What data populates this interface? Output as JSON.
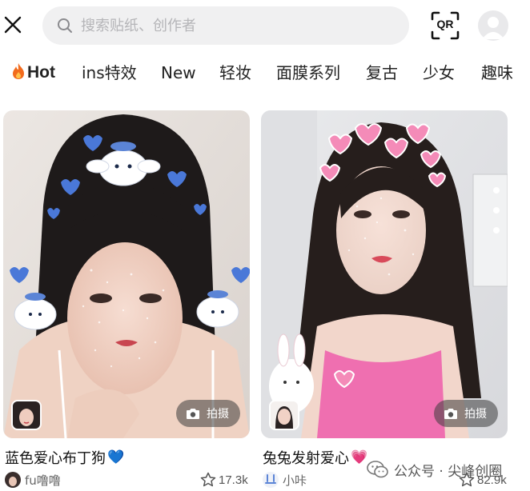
{
  "search": {
    "placeholder": "搜索贴纸、创作者"
  },
  "topbar": {
    "qr_label": "QR"
  },
  "tabs": [
    {
      "label": "Hot",
      "active": true,
      "icon": "fire-icon"
    },
    {
      "label": "ins特效"
    },
    {
      "label": "New"
    },
    {
      "label": "轻妆"
    },
    {
      "label": "面膜系列"
    },
    {
      "label": "复古"
    },
    {
      "label": "少女"
    },
    {
      "label": "趣味"
    }
  ],
  "cards": [
    {
      "title": "蓝色爱心布丁狗",
      "title_emoji": "💙",
      "shoot_label": "拍摄",
      "creator": "fu噜噜",
      "likes": "17.3k",
      "accent": "#4a78d8"
    },
    {
      "title": "兔兔发射爱心",
      "title_emoji": "💗",
      "shoot_label": "拍摄",
      "creator": "小咔",
      "likes": "82.9k",
      "accent": "#f07ab0"
    }
  ],
  "watermark": {
    "text": "公众号 · 尖峰创圈"
  },
  "colors": {
    "search_bg": "#f0f0f1",
    "fire": "#f26b1d",
    "heart_blue": "#4a78d8",
    "heart_pink": "#f48bb8"
  }
}
